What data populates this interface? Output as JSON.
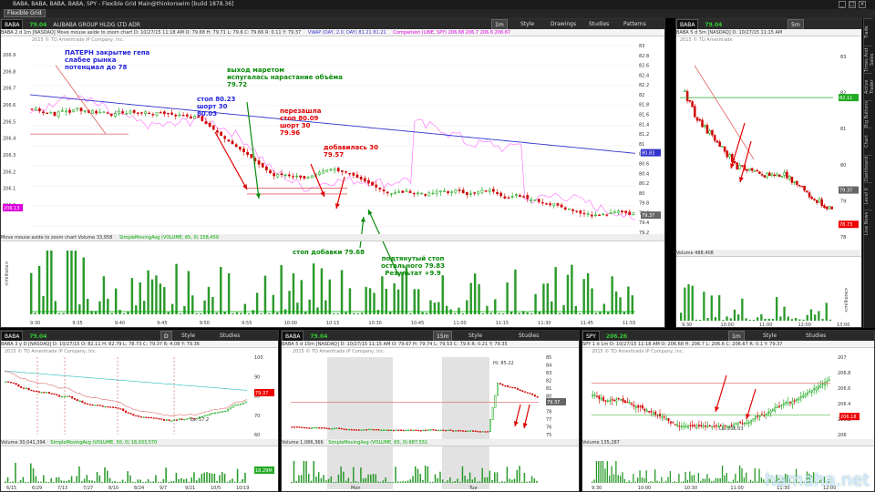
{
  "window": {
    "title": "BABA, BABA, BABA, BABA, SPY - Flexible Grid Main@thinkorswim [build 1878.36]",
    "menu_label": "Flexible Grid"
  },
  "main_chart": {
    "symbol": "BABA",
    "price": "79.04",
    "company": "ALIBABA GROUP HLDG LTD ADR",
    "timeframe": "1m",
    "style_btn": "Style",
    "drawings_btn": "Drawings",
    "studies_btn": "Studies",
    "patterns_btn": "Patterns",
    "header": "BABA 2 d 1m [NASDAQ]  Move mouse aside to zoom chart  D: 10/27/15 11:18 AM  O: 79.68  H: 79.71  L: 79.6  C: 79.66  R: 0.11  Y: 79.37",
    "vwap": "VWAP (DAY, 2.0, DAY)  81.21  81.21",
    "comparison": "Comparison (LINE, SPY)  206.68  206.7  206.6  206.67",
    "copyright": "2015 © TD Ameritrade IP Company, Inc.",
    "volume_header": "Move mouse aside to zoom chart  Volume  33,958",
    "volume_study": "SimpleMovingAvg (VOLUME, 65, 0)  158,459",
    "left_ticks": [
      "206.9",
      "206.8",
      "206.7",
      "206.6",
      "206.5",
      "206.4",
      "206.3",
      "206.2",
      "206.1",
      "206.0"
    ],
    "right_ticks": [
      "83",
      "82.8",
      "82.6",
      "82.4",
      "82.2",
      "82",
      "81.8",
      "81.6",
      "81.4",
      "81.2",
      "81",
      "80.8",
      "80.6",
      "80.4",
      "80.2",
      "80",
      "79.8",
      "79.6",
      "79.4",
      "79.2"
    ],
    "time_ticks": [
      "9:30",
      "9:35",
      "9:40",
      "9:45",
      "9:50",
      "9:55",
      "10:00",
      "10:15",
      "10:30",
      "10:45",
      "11:00",
      "11:15",
      "11:30",
      "11:45",
      "11:55"
    ],
    "price_marker": "79.37",
    "ma_marker": "80.83",
    "left_marker": "206.13",
    "volume_unit": "<millions>"
  },
  "annotations": {
    "pattern": "ПАТЕРН закрытие гепа\nслабее рынка\nпотенциал до 78",
    "market_exit": "выход маретом\nиспугалась нарастание объёма\n79.72",
    "stop1": "стоп 80.23\nшорт  30\n80.03",
    "reentry": "перезашла\nстоп 80.09\nшорт 30\n79.96",
    "added": "добавилась 30\n79.57",
    "stop_add": "стоп добавки 79.68",
    "trailing": "подтянутый стоп\nостального 79.83\nРезультат +9.9"
  },
  "right_top_chart": {
    "symbol": "BABA",
    "price": "79.04",
    "timeframe": "5m",
    "header": "BABA 5 d 5m [NASDAQ]  D: 10/27/15 11:15 AM",
    "copyright": "2015 © TD Ameritrade",
    "right_ticks": [
      "83",
      "82",
      "81",
      "80",
      "79",
      "78"
    ],
    "marker_green": "82.11",
    "marker_price": "79.37",
    "marker_red": "78.73",
    "volume_header": "Volume  488,408",
    "time_ticks": [
      "9:30",
      "10:00",
      "11:00",
      "12:00",
      "13:00"
    ],
    "volume_unit": "<millions>"
  },
  "sidebar_tabs": [
    "Trade",
    "Times And Sales",
    "Active Trader",
    "Big Buttons",
    "Chart",
    "Dashboard",
    "Level II",
    "Live News"
  ],
  "bottom1": {
    "symbol": "BABA",
    "price": "79.04",
    "timeframe": "D",
    "header": "BABA 3 y D [NASDAQ]  D: 10/27/15  O: 82.11  H: 82.79  L: 78.73  C: 79.37  R: 4.08  Y: 79.36",
    "copyright": "2015 © TD Ameritrade IP Company, Inc.",
    "low_label": "Lo: 57.2",
    "volume_header": "Volume  30,041,394",
    "volume_study": "SimpleMovingAvg (VOLUME, 50, 0)  18,033,570",
    "time_ticks": [
      "6/15",
      "6/29",
      "7/13",
      "7/27",
      "8/10",
      "8/24",
      "9/7",
      "9/21",
      "10/5",
      "10/19"
    ],
    "right_ticks": [
      "100",
      "90",
      "80",
      "70",
      "60"
    ],
    "marker": "79.37",
    "vol_marker": "18.29M"
  },
  "bottom2": {
    "symbol": "BABA",
    "price": "79.04",
    "timeframe": "15m",
    "header": "BABA 5 d 15m [NASDAQ]  D: 10/27/15 11:15 AM  O: 79.67  H: 79.74  L: 79.53  C: 79.6  R: 0.21  Y: 79.35",
    "copyright": "2015 © TD Ameritrade IP Company, Inc.",
    "hi_label": "Hi: 85.22",
    "volume_header": "Volume  1,086,366",
    "volume_study": "SimpleMovingAvg (VOLUME, 65, 0)  687,551",
    "time_ticks": [
      "Mon",
      "Tue"
    ],
    "right_ticks": [
      "85",
      "84",
      "83",
      "82",
      "81",
      "80",
      "79",
      "78",
      "77",
      "76",
      "75"
    ],
    "marker": "79.37"
  },
  "bottom3": {
    "symbol": "SPY",
    "price": "206.26",
    "timeframe": "1m",
    "header": "SPY 1 d 1m  D: 10/27/15 11:18 AM  O: 206.68  H: 206.7  L: 206.6  C: 206.67  R: 0.1  Y: 79.37",
    "copyright": "2015 © TD Ameritrade IP Company, Inc.",
    "low_label": "Lo: 206.03",
    "volume_header": "Volume  135,287",
    "time_ticks": [
      "9:30",
      "10:00",
      "10:30",
      "11:00",
      "11:30",
      "12:00"
    ],
    "right_ticks": [
      "207",
      "206.8",
      "206.6",
      "206.4",
      "206.2",
      "206"
    ],
    "marker": "206.18"
  },
  "watermark": "hamaha.net",
  "colors": {
    "up_candle": "#00a000",
    "down_candle": "#d00000",
    "vwap": "#3333cc",
    "comparison": "#ff66ff",
    "arrow_red": "#e00000",
    "arrow_green": "#0a8a0a"
  }
}
